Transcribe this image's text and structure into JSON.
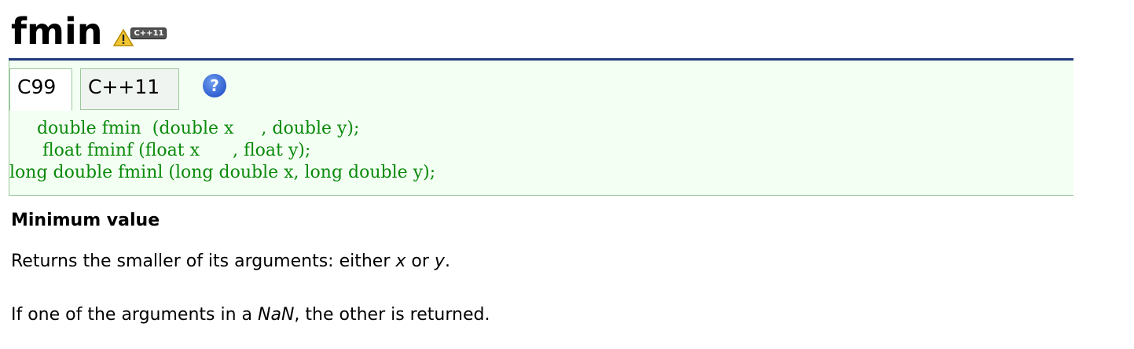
{
  "page": {
    "title": "fmin",
    "badge_label": "C++11"
  },
  "tabs": [
    {
      "label": "C99",
      "active": true
    },
    {
      "label": "C++11",
      "active": false
    }
  ],
  "help": {
    "glyph": "?"
  },
  "prototypes": {
    "lines": [
      "     double fmin  (double x     , double y);",
      "      float fminf (float x      , float y);",
      "long double fminl (long double x, long double y);"
    ]
  },
  "description": {
    "heading": "Minimum value",
    "p1": {
      "before": "Returns the smaller of its arguments: either ",
      "x": "x",
      "mid": " or ",
      "y": "y",
      "after": "."
    },
    "p2": {
      "before": "If one of the arguments in a ",
      "nan": "NaN",
      "after": ", the other is returned."
    }
  },
  "colors": {
    "code_green": "#0a8a0a",
    "box_border": "#1f3a7a",
    "box_bg": "#f4fff4",
    "help_blue": "#2f5fd0"
  },
  "icons": {
    "warning": "warning-icon",
    "help": "help-icon"
  }
}
